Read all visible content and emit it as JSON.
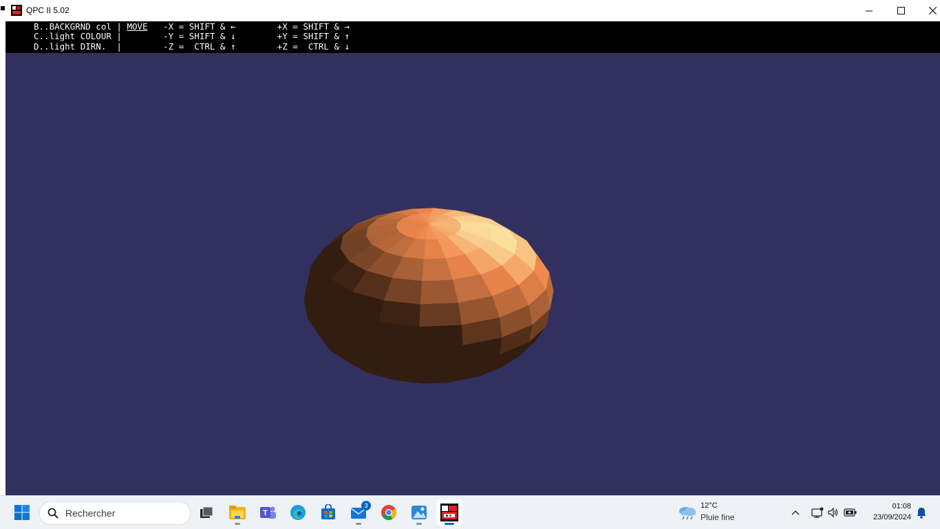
{
  "window": {
    "title": "QPC II 5.02",
    "background_color": "#32305f"
  },
  "menu": {
    "line1": {
      "a": "B..BACKGRND col | ",
      "b": "MOVE",
      "c": "   -X = SHIFT & ←        +X = SHIFT & →"
    },
    "line2": "C..light COLOUR |        -Y = SHIFT & ↓        +Y = SHIFT & ↑",
    "line3": "D..light DIRN.  |        -Z =  CTRL & ↑        +Z =  CTRL & ↓"
  },
  "scene": {
    "object": "shaded-ellipsoid",
    "base_color": "#f28a4e",
    "highlight_color": "#fbe0a0",
    "shadow_color": "#1e0f07"
  },
  "taskbar": {
    "search_placeholder": "Rechercher",
    "mail_badge": "3",
    "apps": [
      "start-icon",
      "search",
      "task-view-icon",
      "file-explorer-icon",
      "teams-icon",
      "edge-icon",
      "store-icon",
      "mail-icon",
      "chrome-icon",
      "photos-icon",
      "qpc-icon"
    ]
  },
  "weather": {
    "temp": "12°C",
    "desc": "Pluie fine"
  },
  "clock": {
    "time": "01:08",
    "date": "23/09/2024"
  }
}
